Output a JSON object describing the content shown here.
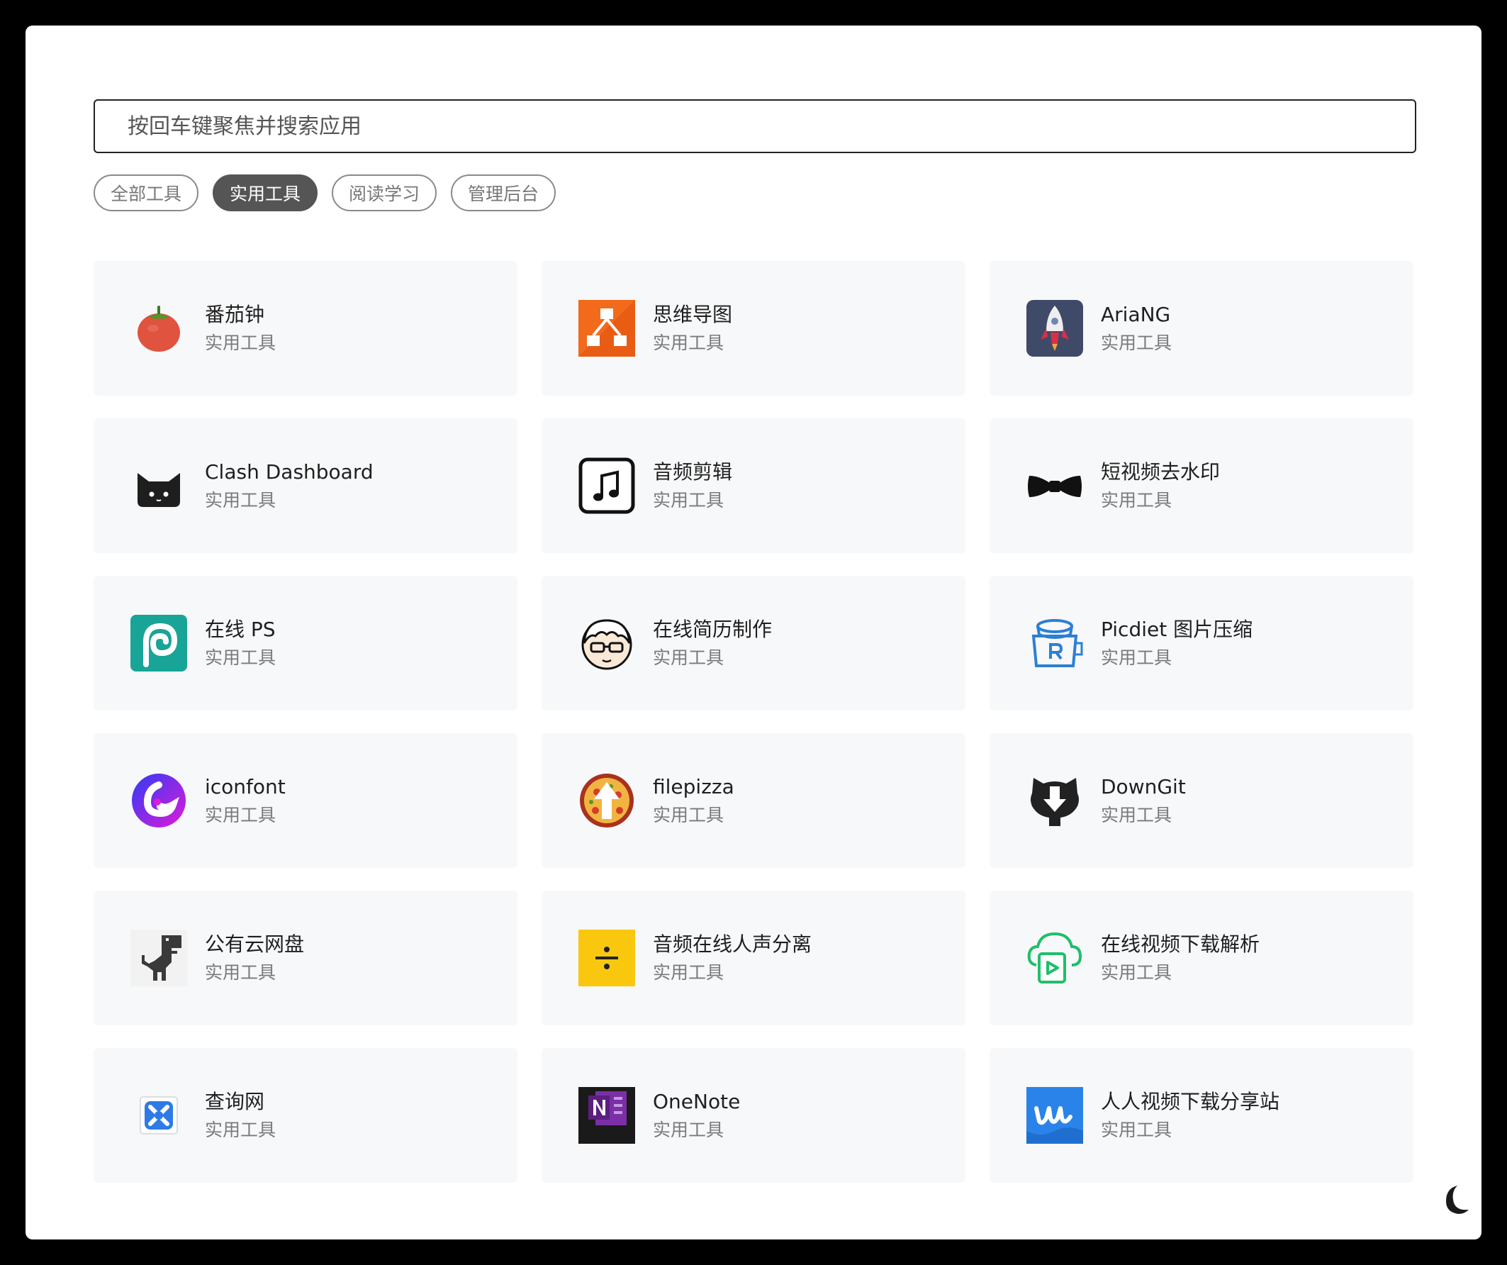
{
  "search": {
    "placeholder": "按回车键聚焦并搜索应用"
  },
  "tabs": [
    {
      "label": "全部工具",
      "active": false
    },
    {
      "label": "实用工具",
      "active": true
    },
    {
      "label": "阅读学习",
      "active": false
    },
    {
      "label": "管理后台",
      "active": false
    }
  ],
  "apps": [
    {
      "name": "番茄钟",
      "category": "实用工具",
      "icon": "tomato-icon"
    },
    {
      "name": "思维导图",
      "category": "实用工具",
      "icon": "mindmap-icon"
    },
    {
      "name": "AriaNG",
      "category": "实用工具",
      "icon": "rocket-icon"
    },
    {
      "name": "Clash Dashboard",
      "category": "实用工具",
      "icon": "cat-icon"
    },
    {
      "name": "音频剪辑",
      "category": "实用工具",
      "icon": "music-note-icon"
    },
    {
      "name": "短视频去水印",
      "category": "实用工具",
      "icon": "bowtie-icon"
    },
    {
      "name": "在线 PS",
      "category": "实用工具",
      "icon": "photopea-icon"
    },
    {
      "name": "在线简历制作",
      "category": "实用工具",
      "icon": "face-glasses-icon"
    },
    {
      "name": "Picdiet 图片压缩",
      "category": "实用工具",
      "icon": "bucket-icon"
    },
    {
      "name": "iconfont",
      "category": "实用工具",
      "icon": "iconfont-icon"
    },
    {
      "name": "filepizza",
      "category": "实用工具",
      "icon": "pizza-icon"
    },
    {
      "name": "DownGit",
      "category": "实用工具",
      "icon": "downgit-icon"
    },
    {
      "name": "公有云网盘",
      "category": "实用工具",
      "icon": "dinosaur-icon"
    },
    {
      "name": "音频在线人声分离",
      "category": "实用工具",
      "icon": "divide-icon"
    },
    {
      "name": "在线视频下载解析",
      "category": "实用工具",
      "icon": "cloud-video-icon"
    },
    {
      "name": "查询网",
      "category": "实用工具",
      "icon": "tools-icon"
    },
    {
      "name": "OneNote",
      "category": "实用工具",
      "icon": "onenote-icon"
    },
    {
      "name": "人人视频下载分享站",
      "category": "实用工具",
      "icon": "wave-icon"
    }
  ],
  "theme_toggle": {
    "icon": "moon-icon"
  },
  "colors": {
    "tab_active_bg": "#555555",
    "card_bg": "#f7f8fa",
    "category_text": "#7a7a7a"
  }
}
